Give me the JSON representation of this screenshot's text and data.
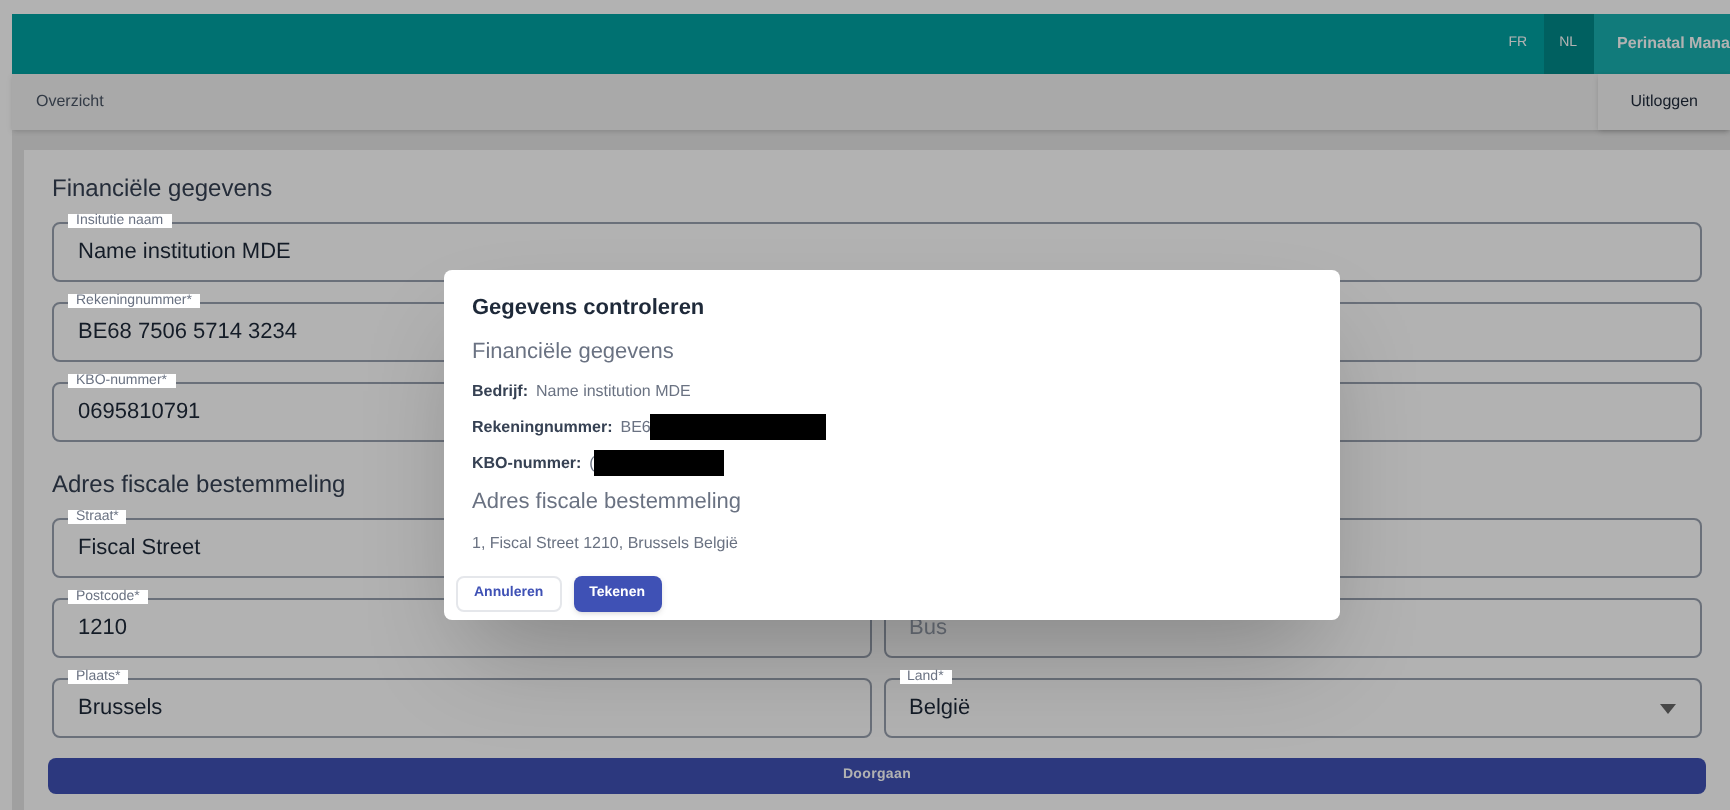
{
  "header": {
    "languages": [
      {
        "label": "FR",
        "selected": false
      },
      {
        "label": "NL",
        "selected": true
      }
    ],
    "app_name": "Perinatal Mana"
  },
  "nav": {
    "link": "Overzicht",
    "logout": "Uitloggen"
  },
  "form": {
    "section_1": "Financiële gegevens",
    "fields_1": [
      {
        "label": "Insitutie naam",
        "value": "Name institution MDE"
      },
      {
        "label": "Rekeningnummer*",
        "value": "BE68 7506 5714 3234"
      },
      {
        "label": "KBO-nummer*",
        "value": "0695810791"
      }
    ],
    "section_2": "Adres fiscale bestemmeling",
    "street": {
      "label": "Straat*",
      "value": "Fiscal Street"
    },
    "postcode": {
      "label": "Postcode*",
      "value": "1210"
    },
    "bus": {
      "placeholder": "Bus"
    },
    "city": {
      "label": "Plaats*",
      "value": "Brussels"
    },
    "country": {
      "label": "Land*",
      "value": "België"
    },
    "submit": "Doorgaan"
  },
  "dialog": {
    "title": "Gegevens controleren",
    "section_1": "Financiële gegevens",
    "rows": [
      {
        "label": "Bedrijf:",
        "value": "Name institution MDE",
        "redacted": false
      },
      {
        "label": "Rekeningnummer:",
        "value": "BE6",
        "redacted": true
      },
      {
        "label": "KBO-nummer:",
        "value": "(",
        "redacted": true
      }
    ],
    "section_2": "Adres fiscale bestemmeling",
    "address": "1, Fiscal Street 1210, Brussels België",
    "buttons": [
      {
        "label": "Annuleren",
        "kind": "outlined"
      },
      {
        "label": "Tekenen",
        "kind": "filled"
      }
    ]
  }
}
